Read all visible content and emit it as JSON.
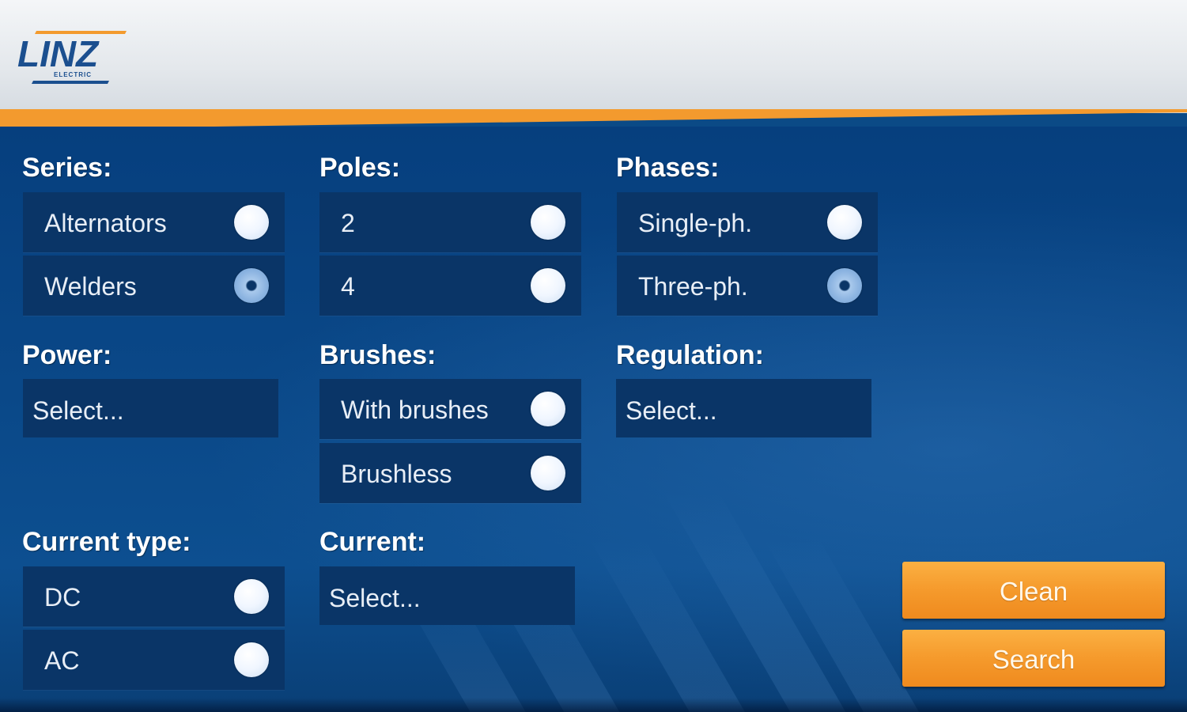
{
  "header": {
    "logo_text": "LINZ",
    "logo_subtext": "ELECTRIC"
  },
  "colors": {
    "accent_orange": "#f39a2e",
    "background_blue": "#0b4a86",
    "row_background": "#0a3567"
  },
  "form": {
    "series": {
      "label": "Series:",
      "options": [
        {
          "label": "Alternators",
          "checked": false
        },
        {
          "label": "Welders",
          "checked": true
        }
      ]
    },
    "poles": {
      "label": "Poles:",
      "options": [
        {
          "label": "2",
          "checked": false
        },
        {
          "label": "4",
          "checked": false
        }
      ]
    },
    "phases": {
      "label": "Phases:",
      "options": [
        {
          "label": "Single-ph.",
          "checked": false
        },
        {
          "label": "Three-ph.",
          "checked": true
        }
      ]
    },
    "power": {
      "label": "Power:",
      "value": "Select..."
    },
    "brushes": {
      "label": "Brushes:",
      "options": [
        {
          "label": "With brushes",
          "checked": false
        },
        {
          "label": "Brushless",
          "checked": false
        }
      ]
    },
    "regulation": {
      "label": "Regulation:",
      "value": "Select..."
    },
    "current_type": {
      "label": "Current type:",
      "options": [
        {
          "label": "DC",
          "checked": false
        },
        {
          "label": "AC",
          "checked": false
        }
      ]
    },
    "current": {
      "label": "Current:",
      "value": "Select..."
    }
  },
  "actions": {
    "clean_label": "Clean",
    "search_label": "Search"
  }
}
